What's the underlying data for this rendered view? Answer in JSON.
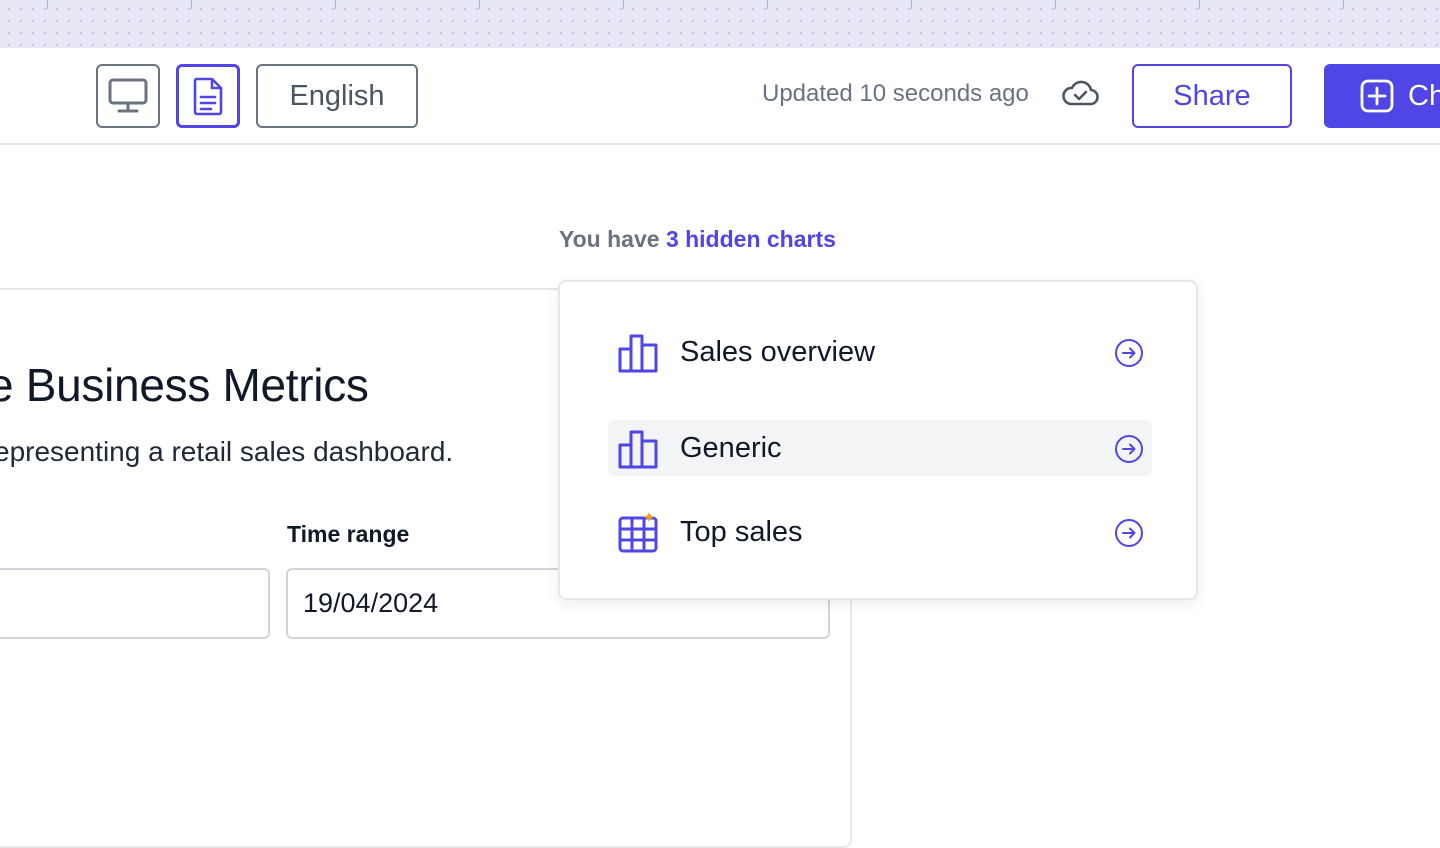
{
  "toolbar": {
    "language_label": "English",
    "updated_text": "Updated 10 seconds ago",
    "share_label": "Share",
    "primary_label": "Ch",
    "desktop_icon": "desktop-icon",
    "document_icon": "document-icon",
    "cloud_icon": "cloud-check-icon"
  },
  "hidden_charts": {
    "prefix": "You have",
    "link_text": "3 hidden charts",
    "items": [
      {
        "label": "Sales overview",
        "icon": "bar-chart-icon",
        "arrow_icon": "arrow-right-circle-icon",
        "active": false
      },
      {
        "label": "Generic",
        "icon": "bar-chart-icon",
        "arrow_icon": "arrow-right-circle-icon",
        "active": true
      },
      {
        "label": "Top sales",
        "icon": "table-icon",
        "arrow_icon": "arrow-right-circle-icon",
        "active": false
      }
    ]
  },
  "report": {
    "title": "e Business Metrics",
    "subtitle": "epresenting a retail sales dashboard.",
    "time_range_label": "Time range",
    "time_range_value": "19/04/2024"
  },
  "colors": {
    "accent": "#4f46e5",
    "strip_background": "#e8e7f5",
    "star_accent": "#f59e0b"
  }
}
